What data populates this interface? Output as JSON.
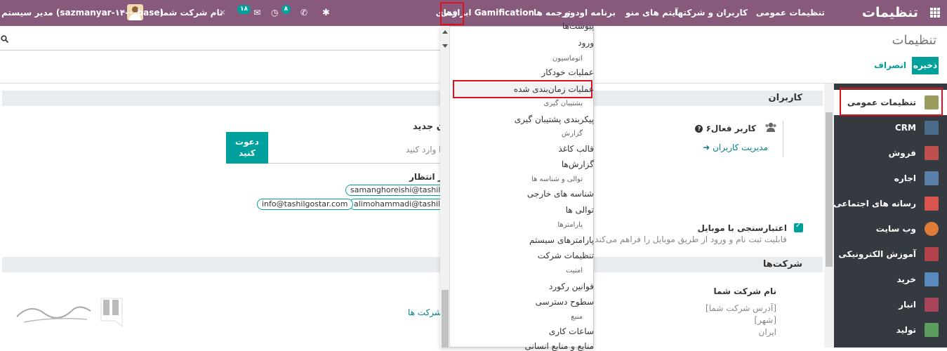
{
  "navbar": {
    "brand": "تنظیمات",
    "menus": [
      "تنظیمات عمومی",
      "کاربران و شرکتها",
      "آیتم های منو",
      "برنامه اودوو",
      "ترجمه ها",
      "ابزارهای Gamification",
      "فنی"
    ],
    "company_name": "نام شرکت شما",
    "user": "مدیر سیستم (sazmanyar-۱۴-۰-base)",
    "chat_count": "۱۸",
    "activity_count": "۸"
  },
  "control": {
    "title": "تنظیمات",
    "save": "ذخیره",
    "discard": "انصراف"
  },
  "sidebar": {
    "items": [
      {
        "label": "تنظیمات عمومی",
        "icon": "gear-icon",
        "color": "#9b9b5b"
      },
      {
        "label": "CRM",
        "icon": "handshake-icon",
        "color": "#4a6b8a"
      },
      {
        "label": "فروش",
        "icon": "chart-icon",
        "color": "#c0504d"
      },
      {
        "label": "اجاره",
        "icon": "rental-icon",
        "color": "#5a7fa8"
      },
      {
        "label": "رسانه های اجتماعی",
        "icon": "thumbs-up-icon",
        "color": "#d9534f"
      },
      {
        "label": "وب سایت",
        "icon": "globe-icon",
        "color": "#e07b39"
      },
      {
        "label": "آموزش الکترونیکی",
        "icon": "elearning-icon",
        "color": "#b5434b"
      },
      {
        "label": "خرید",
        "icon": "card-icon",
        "color": "#5a8bbf"
      },
      {
        "label": "انبار",
        "icon": "box-icon",
        "color": "#a9455a"
      },
      {
        "label": "تولید",
        "icon": "wrench-icon",
        "color": "#5b9e5e"
      }
    ]
  },
  "users_section": {
    "title": "کاربران",
    "active_users": "۶کاربر فعال",
    "manage_users": "مدیریت کاربران",
    "invite_title": "ن جدید",
    "invite_button_line1": "دعوت",
    "invite_button_line2": "کنید",
    "email_placeholder": "را وارد کنید",
    "pending_label": "در انتظار:",
    "pending": [
      "samanghoreishi@tashilgo",
      "alimohammadi@tashilgo",
      "info@tashilgostar.com"
    ],
    "mobile_auth_title": "اعتبارسنجی با موبایل",
    "mobile_auth_desc": "قابلیت ثبت نام و ورود از طریق موبایل را فراهم می‌کند"
  },
  "companies_section": {
    "title": "شرکت‌ها",
    "company_name_label": "نام شرکت شما",
    "address": "[آدرس شرکت شما]",
    "city": "[شهر]",
    "country": "ایران",
    "companies_link": "شرکت ها"
  },
  "dropdown": {
    "items": [
      {
        "kind": "item",
        "label": "پیوست‌ها"
      },
      {
        "kind": "item",
        "label": "ورود"
      },
      {
        "kind": "head",
        "label": "اتوماسیون"
      },
      {
        "kind": "item",
        "label": "عملیات خودکار"
      },
      {
        "kind": "item",
        "label": "عملیات زمان‌بندی شده"
      },
      {
        "kind": "head",
        "label": "پشتیبان گیری"
      },
      {
        "kind": "item",
        "label": "پیکربندی پشتیبان گیری"
      },
      {
        "kind": "head",
        "label": "گزارش"
      },
      {
        "kind": "item",
        "label": "قالب کاغذ"
      },
      {
        "kind": "item",
        "label": "گزارش‌ها"
      },
      {
        "kind": "head",
        "label": "توالی و شناسه ها"
      },
      {
        "kind": "item",
        "label": "شناسه های خارجی"
      },
      {
        "kind": "item",
        "label": "توالی ها"
      },
      {
        "kind": "head",
        "label": "پارامترها"
      },
      {
        "kind": "item",
        "label": "پارامترهای سیستم"
      },
      {
        "kind": "item",
        "label": "تنظیمات شرکت"
      },
      {
        "kind": "head",
        "label": "امنیت"
      },
      {
        "kind": "item",
        "label": "قوانین رکورد"
      },
      {
        "kind": "item",
        "label": "سطوح دسترسی"
      },
      {
        "kind": "head",
        "label": "منبع"
      },
      {
        "kind": "item",
        "label": "ساعات کاری"
      },
      {
        "kind": "item",
        "label": "منابع و منابع انسانی"
      }
    ]
  }
}
